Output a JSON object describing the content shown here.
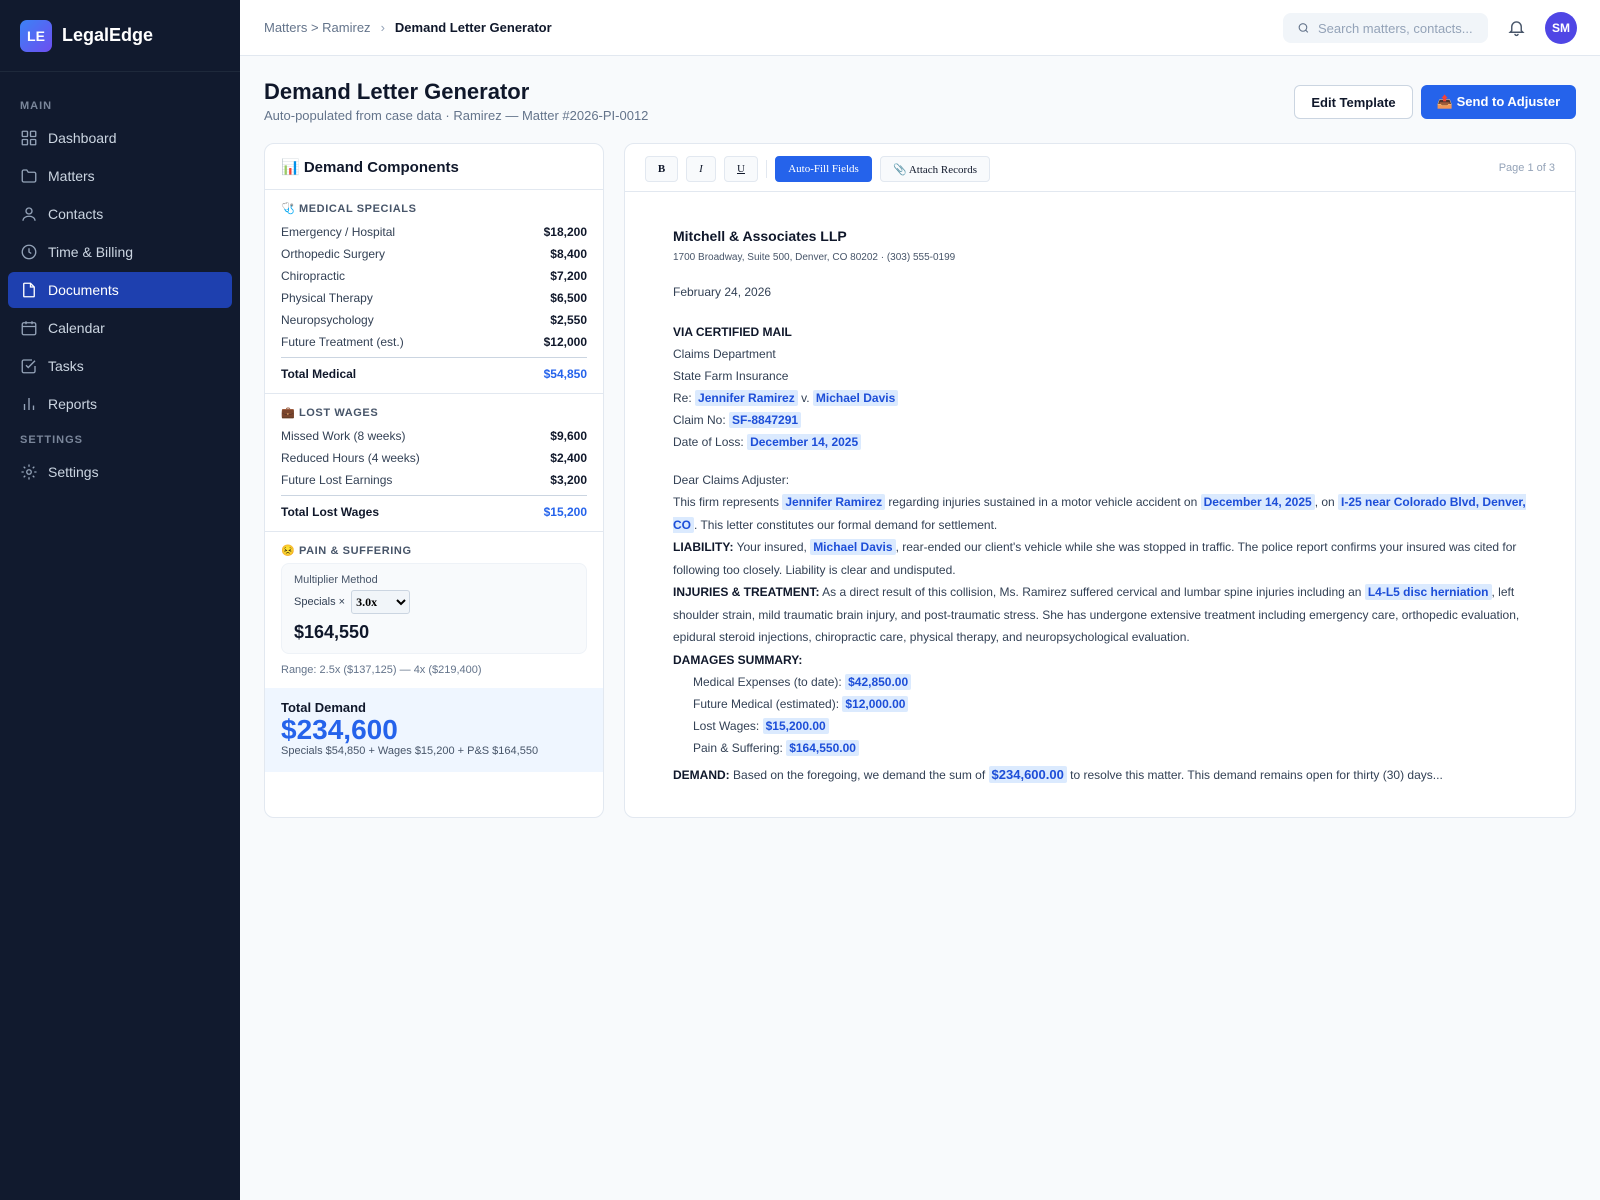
{
  "app": {
    "logo": "LE",
    "name": "LegalEdge"
  },
  "sidebar": {
    "main_label": "MAIN",
    "settings_label": "SETTINGS",
    "items": [
      {
        "label": "Dashboard",
        "icon": "dashboard-icon"
      },
      {
        "label": "Matters",
        "icon": "folder-icon"
      },
      {
        "label": "Contacts",
        "icon": "user-icon"
      },
      {
        "label": "Time & Billing",
        "icon": "clock-icon"
      },
      {
        "label": "Documents",
        "icon": "document-icon",
        "active": true
      },
      {
        "label": "Calendar",
        "icon": "calendar-icon"
      },
      {
        "label": "Tasks",
        "icon": "task-check-icon"
      },
      {
        "label": "Reports",
        "icon": "bar-chart-icon"
      }
    ],
    "settings_item": {
      "label": "Settings",
      "icon": "gear-icon"
    }
  },
  "topbar": {
    "breadcrumb_parent": "Matters > Ramirez",
    "breadcrumb_sep": "›",
    "breadcrumb_current": "Demand Letter Generator",
    "search_placeholder": "Search matters, contacts...",
    "avatar": "SM"
  },
  "header": {
    "title": "Demand Letter Generator",
    "subtitle": "Auto-populated from case data · Ramirez — Matter #2026-PI-0012",
    "edit_label": "Edit Template",
    "send_label": "📤 Send to Adjuster"
  },
  "components": {
    "title": "📊 Demand Components",
    "medical": {
      "title": "🩺 MEDICAL SPECIALS",
      "items": [
        {
          "label": "Emergency / Hospital",
          "value": "$18,200"
        },
        {
          "label": "Orthopedic Surgery",
          "value": "$8,400"
        },
        {
          "label": "Chiropractic",
          "value": "$7,200"
        },
        {
          "label": "Physical Therapy",
          "value": "$6,500"
        },
        {
          "label": "Neuropsychology",
          "value": "$2,550"
        },
        {
          "label": "Future Treatment (est.)",
          "value": "$12,000"
        }
      ],
      "total_label": "Total Medical",
      "total_value": "$54,850"
    },
    "wages": {
      "title": "💼 LOST WAGES",
      "items": [
        {
          "label": "Missed Work (8 weeks)",
          "value": "$9,600"
        },
        {
          "label": "Reduced Hours (4 weeks)",
          "value": "$2,400"
        },
        {
          "label": "Future Lost Earnings",
          "value": "$3,200"
        }
      ],
      "total_label": "Total Lost Wages",
      "total_value": "$15,200"
    },
    "pain": {
      "title": "😣 PAIN & SUFFERING",
      "method_label": "Multiplier Method",
      "specials_label": "Specials ×",
      "multiplier": "3.0x",
      "amount": "$164,550",
      "range": "Range: 2.5x ($137,125) — 4x ($219,400)"
    },
    "total": {
      "label": "Total Demand",
      "value": "$234,600",
      "breakdown": "Specials $54,850 + Wages $15,200 + P&S $164,550"
    }
  },
  "editor": {
    "bold": "B",
    "italic": "I",
    "underline": "U",
    "autofill": "Auto-Fill Fields",
    "attach": "📎 Attach Records",
    "page": "Page 1 of 3"
  },
  "letter": {
    "firm": "Mitchell & Associates LLP",
    "address": "1700 Broadway, Suite 500, Denver, CO 80202 · (303) 555-0199",
    "date": "February 24, 2026",
    "via": "VIA CERTIFIED MAIL",
    "dept": "Claims Department",
    "insurer": "State Farm Insurance",
    "re_label": "Re:",
    "plaintiff": "Jennifer Ramirez",
    "v": "v.",
    "defendant": "Michael Davis",
    "claim_label": "Claim No:",
    "claim_no": "SF-8847291",
    "loss_label": "Date of Loss:",
    "loss_date": "December 14, 2025",
    "salutation": "Dear Claims Adjuster:",
    "p1_a": "This firm represents",
    "p1_b": "regarding injuries sustained in a motor vehicle accident on",
    "p1_c": ", on",
    "location": "I-25 near Colorado Blvd, Denver, CO",
    "p1_d": ". This letter constitutes our formal demand for settlement.",
    "liability_label": "LIABILITY:",
    "p2_a": "Your insured,",
    "p2_b": ", rear-ended our client's vehicle while she was stopped in traffic. The police report confirms your insured was cited for following too closely. Liability is clear and undisputed.",
    "injuries_label": "INJURIES & TREATMENT:",
    "p3_a": "As a direct result of this collision, Ms. Ramirez suffered cervical and lumbar spine injuries including an",
    "injury": "L4-L5 disc herniation",
    "p3_b": ", left shoulder strain, mild traumatic brain injury, and post-traumatic stress. She has undergone extensive treatment including emergency care, orthopedic evaluation, epidural steroid injections, chiropractic care, physical therapy, and neuropsychological evaluation.",
    "damages_label": "DAMAGES SUMMARY:",
    "damages": [
      {
        "label": "Medical Expenses (to date):",
        "value": "$42,850.00"
      },
      {
        "label": "Future Medical (estimated):",
        "value": "$12,000.00"
      },
      {
        "label": "Lost Wages:",
        "value": "$15,200.00"
      },
      {
        "label": "Pain & Suffering:",
        "value": "$164,550.00"
      }
    ],
    "demand_label": "DEMAND:",
    "demand_a": "Based on the foregoing, we demand the sum of",
    "demand_amount": "$234,600.00",
    "demand_b": "to resolve this matter. This demand remains open for thirty (30) days..."
  },
  "colors": {
    "sidebar_bg": "#111a2e",
    "accent": "#2563eb",
    "active_nav": "#1e40af",
    "highlight_bg": "#dbeafe"
  }
}
